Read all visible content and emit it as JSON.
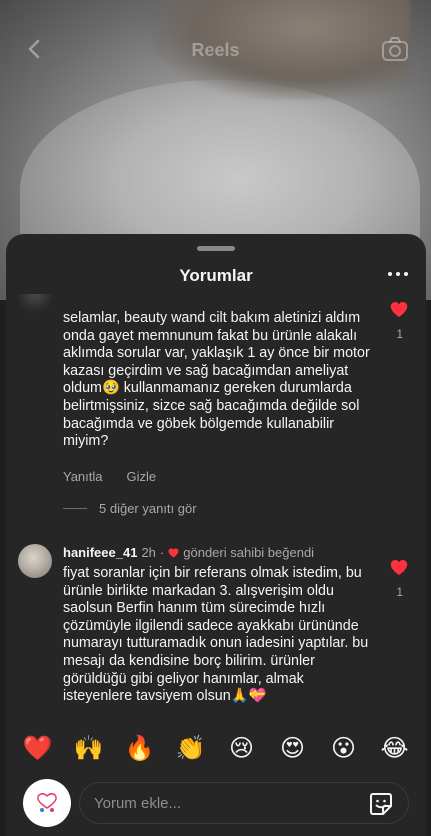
{
  "reel": {
    "title": "Reels"
  },
  "sheet": {
    "title": "Yorumlar"
  },
  "comments": [
    {
      "text": "selamlar, beauty wand cilt bakım aletinizi aldım onda gayet memnunum fakat bu ürünle alakalı aklımda sorular var, yaklaşık 1 ay önce bir motor kazası geçirdim ve sağ bacağımdan ameliyat oldum🥹 kullanmamanız gereken durumlarda belirtmişsiniz, sizce sağ bacağımda değilde sol bacağımda ve göbek bölgemde kullanabilir miyim?",
      "likes": "1",
      "reply_label": "Yanıtla",
      "hide_label": "Gizle",
      "more_replies": "5 diğer yanıtı gör"
    },
    {
      "username": "hanifeee_41",
      "time": "2h",
      "creator_liked": "gönderi sahibi beğendi",
      "text": "fiyat soranlar için bir referans olmak istedim, bu ürünle birlikte markadan 3. alışverişim oldu saolsun Berfin hanım tüm sürecimde hızlı çözümüyle ilgilendi sadece ayakkabı ürününde numarayı tutturamadık onun iadesini yaptılar. bu mesajı da kendisine borç bilirim. ürünler görüldüğü gibi geliyor hanımlar, almak isteyenlere tavsiyem olsun🙏💝",
      "likes": "1"
    }
  ],
  "emoji_bar": [
    "❤️",
    "🙌",
    "🔥",
    "👏",
    "😢",
    "😍",
    "😮",
    "😂"
  ],
  "input": {
    "placeholder": "Yorum ekle..."
  },
  "colors": {
    "heart": "#ff3040",
    "sheet_bg": "#262626",
    "secondary_text": "#a8a8a8"
  }
}
